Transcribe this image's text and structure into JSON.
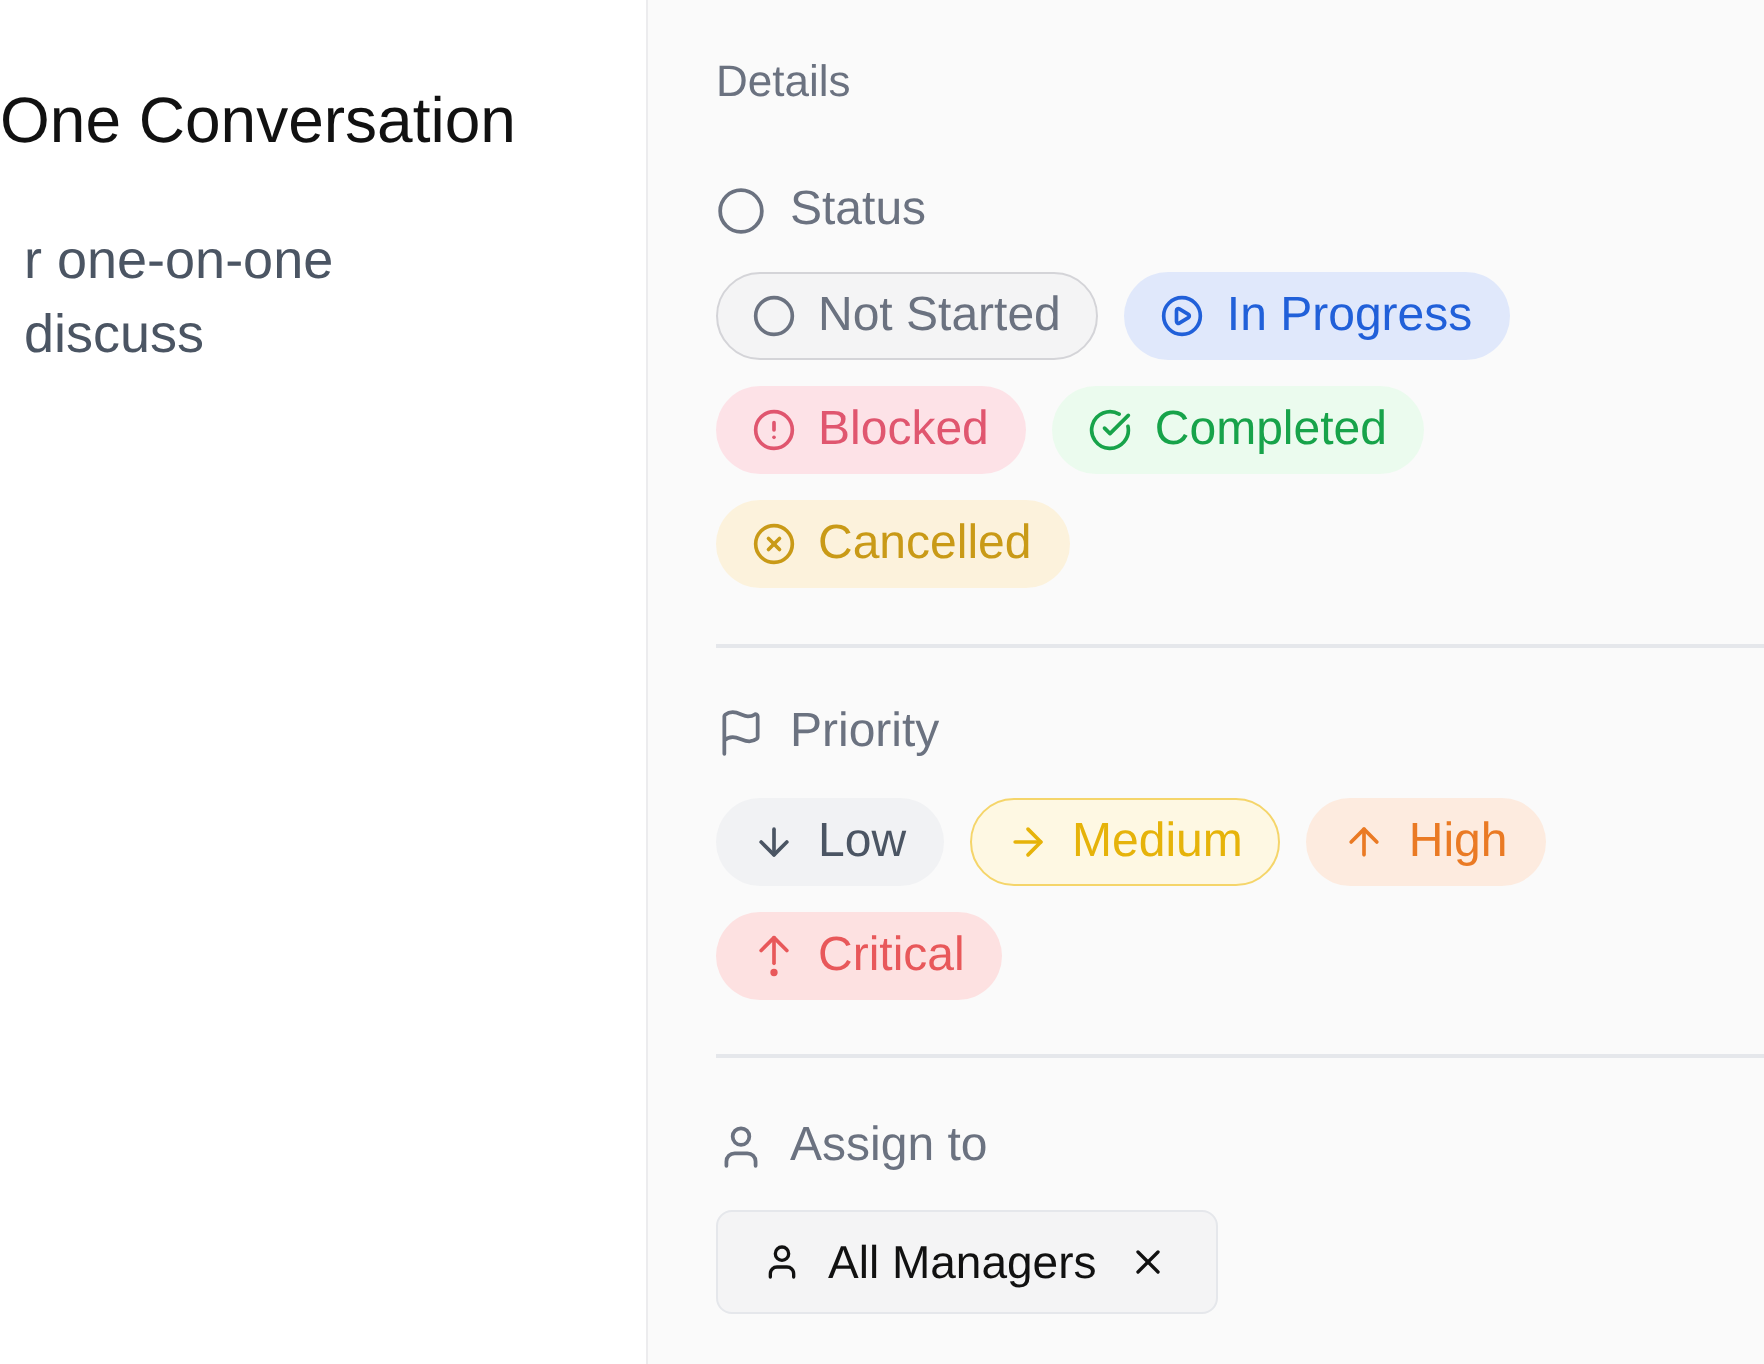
{
  "main": {
    "title": "One Conversation",
    "description_lines": [
      "r one-on-one",
      "discuss"
    ]
  },
  "details": {
    "heading": "Details",
    "status": {
      "label": "Status",
      "options": [
        {
          "label": "Not Started",
          "kind": "not_started",
          "selected": true
        },
        {
          "label": "In Progress",
          "kind": "in_progress",
          "selected": false
        },
        {
          "label": "Blocked",
          "kind": "blocked",
          "selected": false
        },
        {
          "label": "Completed",
          "kind": "completed",
          "selected": false
        },
        {
          "label": "Cancelled",
          "kind": "cancelled",
          "selected": false
        }
      ]
    },
    "priority": {
      "label": "Priority",
      "options": [
        {
          "label": "Low",
          "kind": "low",
          "selected": false
        },
        {
          "label": "Medium",
          "kind": "medium",
          "selected": true
        },
        {
          "label": "High",
          "kind": "high",
          "selected": false
        },
        {
          "label": "Critical",
          "kind": "critical",
          "selected": false
        }
      ]
    },
    "assign": {
      "label": "Assign to",
      "assignees": [
        {
          "name": "All Managers"
        }
      ]
    }
  }
}
